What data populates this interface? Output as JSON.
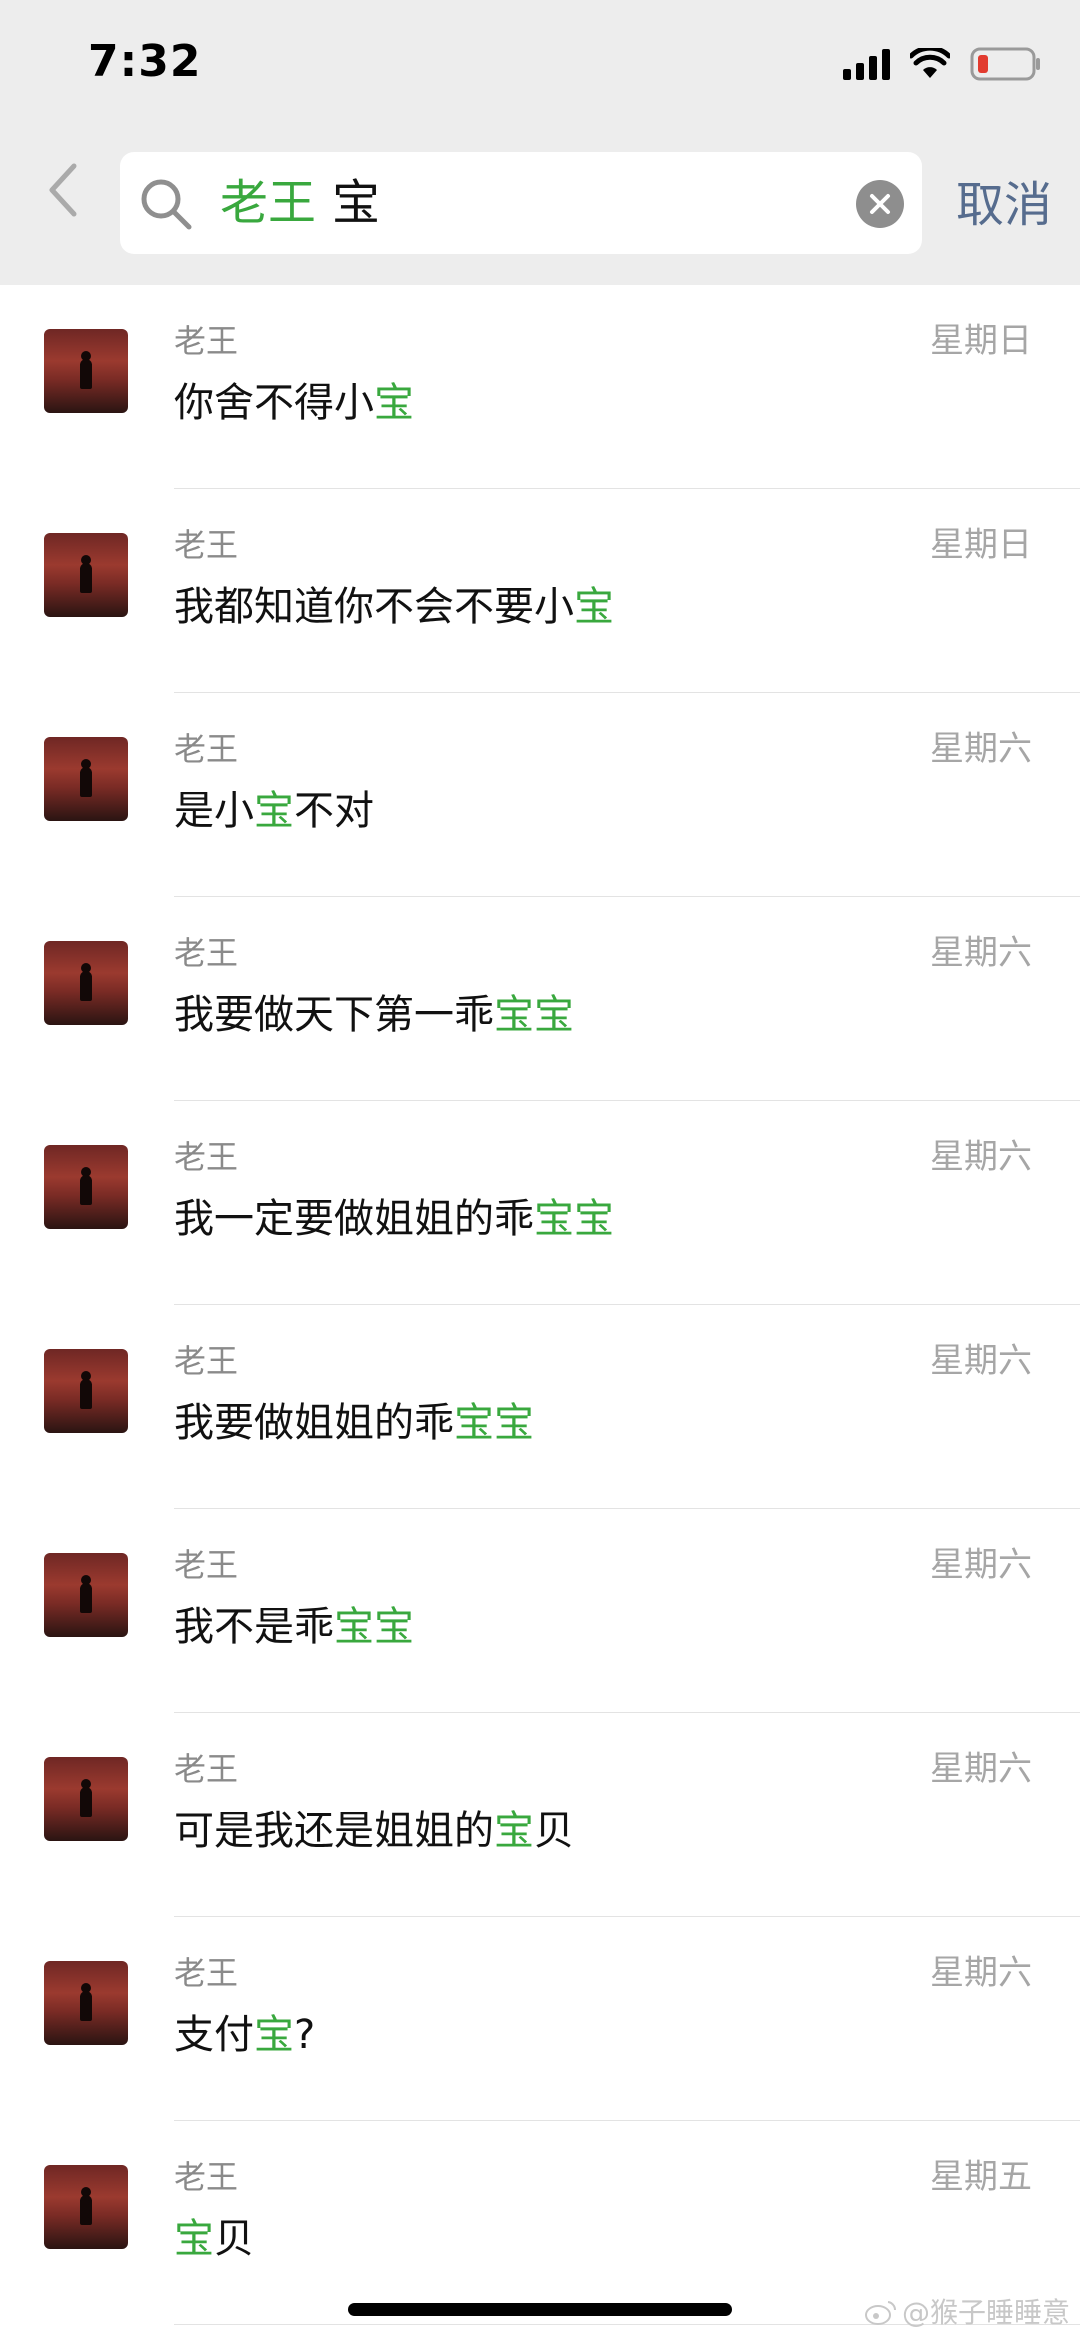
{
  "status_bar": {
    "time": "7:32"
  },
  "search": {
    "tag": "老王",
    "query": "宝",
    "cancel_label": "取消"
  },
  "results": [
    {
      "sender": "老王",
      "day": "星期日",
      "parts": [
        {
          "t": "你舍不得小"
        },
        {
          "t": "宝",
          "hl": true
        }
      ]
    },
    {
      "sender": "老王",
      "day": "星期日",
      "parts": [
        {
          "t": "我都知道你不会不要小"
        },
        {
          "t": "宝",
          "hl": true
        }
      ]
    },
    {
      "sender": "老王",
      "day": "星期六",
      "parts": [
        {
          "t": "是小"
        },
        {
          "t": "宝",
          "hl": true
        },
        {
          "t": "不对"
        }
      ]
    },
    {
      "sender": "老王",
      "day": "星期六",
      "parts": [
        {
          "t": "我要做天下第一乖"
        },
        {
          "t": "宝宝",
          "hl": true
        }
      ]
    },
    {
      "sender": "老王",
      "day": "星期六",
      "parts": [
        {
          "t": "我一定要做姐姐的乖"
        },
        {
          "t": "宝宝",
          "hl": true
        }
      ]
    },
    {
      "sender": "老王",
      "day": "星期六",
      "parts": [
        {
          "t": "我要做姐姐的乖"
        },
        {
          "t": "宝宝",
          "hl": true
        }
      ]
    },
    {
      "sender": "老王",
      "day": "星期六",
      "parts": [
        {
          "t": "我不是乖"
        },
        {
          "t": "宝宝",
          "hl": true
        }
      ]
    },
    {
      "sender": "老王",
      "day": "星期六",
      "parts": [
        {
          "t": "可是我还是姐姐的"
        },
        {
          "t": "宝",
          "hl": true
        },
        {
          "t": "贝"
        }
      ]
    },
    {
      "sender": "老王",
      "day": "星期六",
      "parts": [
        {
          "t": "支付"
        },
        {
          "t": "宝",
          "hl": true
        },
        {
          "t": "?"
        }
      ]
    },
    {
      "sender": "老王",
      "day": "星期五",
      "parts": [
        {
          "t": "宝",
          "hl": true
        },
        {
          "t": "贝"
        }
      ]
    }
  ],
  "watermark": "@猴子睡睡意",
  "colors": {
    "highlight": "#39a83e",
    "header_bg": "#ededed",
    "cancel": "#566c8e"
  },
  "icons": [
    "back-chevron-icon",
    "search-icon",
    "clear-icon",
    "signal-icon",
    "wifi-icon",
    "battery-icon",
    "weibo-icon"
  ]
}
